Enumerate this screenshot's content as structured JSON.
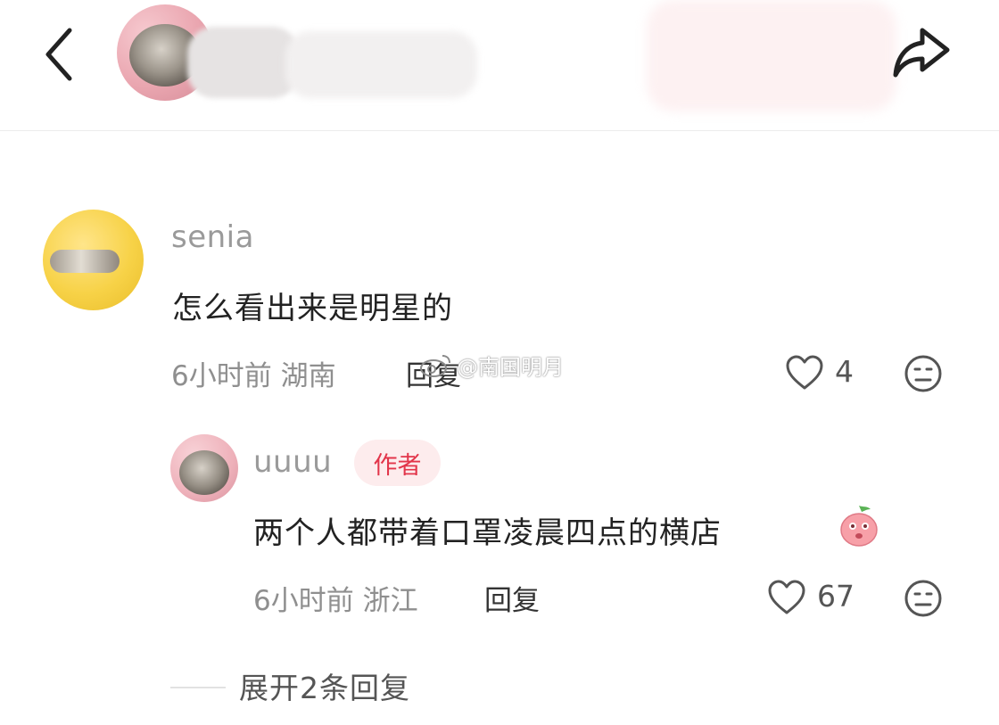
{
  "header": {
    "back_icon": "chevron-left-icon",
    "share_icon": "share-icon"
  },
  "comment": {
    "username": "senia",
    "text": "怎么看出来是明星的",
    "time_location": "6小时前 湖南",
    "reply_label": "回复",
    "likes": "4"
  },
  "reply": {
    "username": "uuuu",
    "badge": "作者",
    "text": "两个人都带着口罩凌晨四点的横店",
    "emoji": "peach-emoji",
    "time_location": "6小时前 浙江",
    "reply_label": "回复",
    "likes": "67"
  },
  "expand": {
    "label": "展开2条回复"
  },
  "watermark": {
    "text": "@南国明月"
  },
  "colors": {
    "author_badge_text": "#e2354a",
    "author_badge_bg": "#fdeced",
    "muted_text": "#8f8f8f"
  }
}
